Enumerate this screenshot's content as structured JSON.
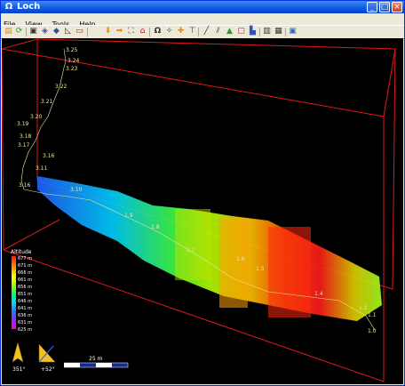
{
  "window": {
    "title": "Loch",
    "app_icon": "omega-icon"
  },
  "titlebar_buttons": [
    "minimize-icon",
    "maximize-icon",
    "close-icon"
  ],
  "menu": [
    "File",
    "View",
    "Tools",
    "Help"
  ],
  "toolbar": {
    "icons": [
      "open-icon",
      "reload-icon",
      "print-icon",
      "render-icon",
      "survey-icon",
      "angle-icon",
      "camera-icon",
      "arrow-down-icon",
      "arrow-right-icon",
      "fullscreen-icon",
      "home-icon",
      "omega-icon",
      "star-icon",
      "plus-icon",
      "sign-icon",
      "pencil-icon",
      "tube-icon",
      "terrain-icon",
      "cube-icon",
      "chart-icon",
      "sidebar-icon",
      "info-icon",
      "window-icon"
    ]
  },
  "stations": [
    "3.25",
    "3.24",
    "3.23",
    "3.22",
    "3.21",
    "3.20",
    "3.19",
    "3.18",
    "3.17",
    "3.16",
    "3.11",
    "3.16",
    "3.10",
    "1.9",
    "1.8",
    "1.7",
    "1.6",
    "1.5",
    "1.4",
    "1.2",
    "1.1",
    "1.0"
  ],
  "legend": {
    "title": "Altitude",
    "values": [
      "677 m",
      "671 m",
      "666 m",
      "661 m",
      "656 m",
      "651 m",
      "646 m",
      "641 m",
      "636 m",
      "631 m",
      "625 m"
    ]
  },
  "compass": {
    "heading": "351°",
    "tilt": "+52°"
  },
  "scale": {
    "label": "25 m"
  },
  "colors": {
    "box": "#E01818",
    "bg": "#000000",
    "title_bar": "#0A5AE0"
  }
}
